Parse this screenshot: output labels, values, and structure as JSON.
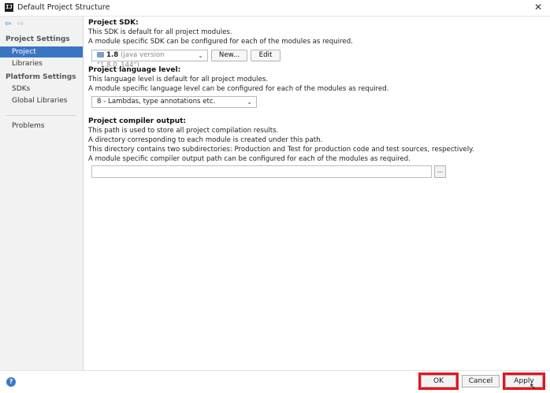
{
  "window": {
    "title": "Default Project Structure",
    "app_icon_text": "IJ",
    "close_glyph": "✕"
  },
  "sidebar": {
    "back_glyph": "⇦",
    "forward_glyph": "⇨",
    "project_settings_header": "Project Settings",
    "project_settings_items": [
      {
        "label": "Project",
        "selected": true
      },
      {
        "label": "Libraries",
        "selected": false
      }
    ],
    "platform_settings_header": "Platform Settings",
    "platform_settings_items": [
      {
        "label": "SDKs"
      },
      {
        "label": "Global Libraries"
      }
    ],
    "problems_label": "Problems"
  },
  "sdk": {
    "title": "Project SDK:",
    "line1": "This SDK is default for all project modules.",
    "line2": "A module specific SDK can be configured for each of the modules as required.",
    "combo_version": "1.8",
    "combo_detail": "(java version \"1.8.0_144\")",
    "new_button": "New...",
    "edit_button": "Edit"
  },
  "language_level": {
    "title": "Project language level:",
    "line1": "This language level is default for all project modules.",
    "line2": "A module specific language level can be configured for each of the modules as required.",
    "selected": "8 - Lambdas, type annotations etc."
  },
  "compiler_output": {
    "title": "Project compiler output:",
    "line1": "This path is used to store all project compilation results.",
    "line2": "A directory corresponding to each module is created under this path.",
    "line3": "This directory contains two subdirectories: Production and Test for production code and test sources, respectively.",
    "line4": "A module specific compiler output path can be configured for each of the modules as required.",
    "path_value": "",
    "browse_label": "..."
  },
  "footer": {
    "help_glyph": "?",
    "ok_label": "OK",
    "cancel_label": "Cancel",
    "apply_label": "Apply"
  },
  "colors": {
    "selection": "#3a75c4",
    "highlight_box": "#e8141c"
  },
  "icons": {
    "back": "back-arrow-icon",
    "forward": "forward-arrow-icon",
    "close": "close-icon",
    "help": "help-icon",
    "sdk": "jdk-folder-icon"
  }
}
